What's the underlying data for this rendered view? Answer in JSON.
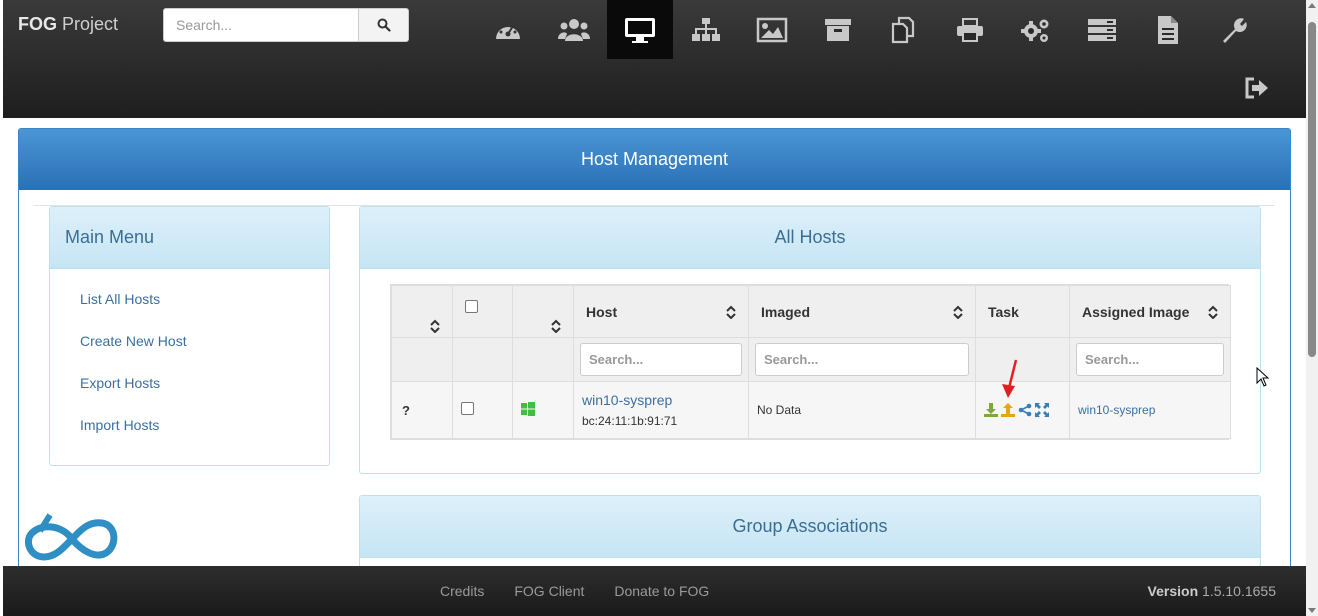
{
  "navbar": {
    "brand_bold": "FOG",
    "brand_rest": " Project",
    "search_placeholder": "Search...",
    "icons": [
      "dashboard-icon",
      "users-icon",
      "desktop-icon",
      "sitemap-icon",
      "image-icon",
      "archive-icon",
      "copy-icon",
      "printer-icon",
      "cogs-icon",
      "server-icon",
      "file-text-icon",
      "wrench-icon"
    ],
    "active_icon": "desktop-icon"
  },
  "main": {
    "heading": "Host Management"
  },
  "side_menu": {
    "title": "Main Menu",
    "items": [
      "List All Hosts",
      "Create New Host",
      "Export Hosts",
      "Import Hosts"
    ]
  },
  "hosts": {
    "title": "All Hosts",
    "columns": [
      "",
      "",
      "",
      "Host",
      "Imaged",
      "Task",
      "Assigned Image"
    ],
    "search_placeholders": {
      "host": "Search...",
      "imaged": "Search...",
      "assigned": "Search..."
    },
    "rows": [
      {
        "status": "?",
        "name": "win10-sysprep",
        "mac": "bc:24:11:1b:91:71",
        "imaged": "No Data",
        "assigned_image": "win10-sysprep"
      }
    ]
  },
  "group": {
    "title": "Group Associations"
  },
  "footer": {
    "links": [
      "Credits",
      "FOG Client",
      "Donate to FOG"
    ],
    "version_label": "Version",
    "version_value": "1.5.10.1655"
  },
  "colors": {
    "accent_blue": "#2a70b4",
    "panel_head": "#c6e5f4",
    "link": "#3b6fa0",
    "windows_green": "#3fbf3f",
    "deploy_green": "#7fa83b",
    "capture_orange": "#e8a317"
  }
}
